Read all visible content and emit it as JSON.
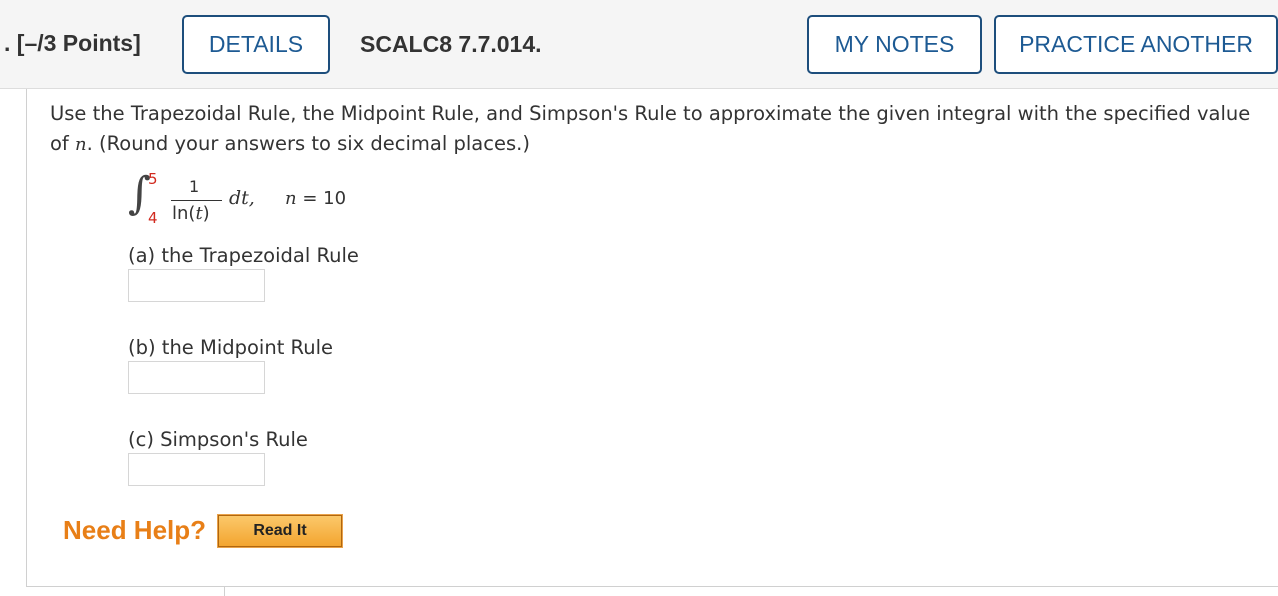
{
  "header": {
    "points": ". [–/3 Points]",
    "details_label": "DETAILS",
    "question_id": "SCALC8 7.7.014.",
    "my_notes_label": "MY NOTES",
    "practice_another_label": "PRACTICE ANOTHER"
  },
  "question": {
    "prompt_part1": "Use the Trapezoidal Rule, the Midpoint Rule, and Simpson's Rule to approximate the given integral with the specified value of ",
    "prompt_var": "n",
    "prompt_part2": ". (Round your answers to six decimal places.)",
    "formula": {
      "upper_limit": "5",
      "lower_limit": "4",
      "numerator": "1",
      "denominator_fn": "ln(",
      "denominator_var": "t",
      "denominator_close": ")",
      "differential": "dt,",
      "n_var": "n",
      "n_value": " = 10"
    },
    "parts": [
      {
        "label": "(a) the Trapezoidal Rule",
        "value": ""
      },
      {
        "label": "(b) the Midpoint Rule",
        "value": ""
      },
      {
        "label": "(c) Simpson's Rule",
        "value": ""
      }
    ]
  },
  "help": {
    "need_help_label": "Need Help?",
    "read_it_label": "Read It"
  },
  "colors": {
    "button_border": "#1d4e7c",
    "button_text": "#1d5a93",
    "limit_red": "#d12a1f",
    "help_orange": "#e87f17",
    "read_it_fill": "#f3a530"
  }
}
